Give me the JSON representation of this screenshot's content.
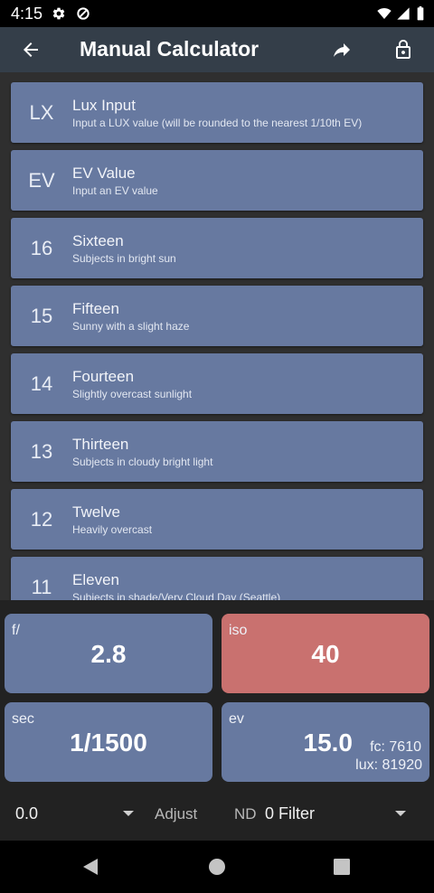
{
  "status_bar": {
    "time": "4:15",
    "left_icons": [
      "gear-icon",
      "data-saver-icon"
    ],
    "right_icons": [
      "wifi-icon",
      "cell-signal-icon",
      "battery-icon"
    ]
  },
  "app_bar": {
    "title": "Manual Calculator",
    "back_icon": "arrow-left-icon",
    "share_icon": "share-icon",
    "lock_icon": "lock-icon"
  },
  "ev_list": [
    {
      "badge": "LX",
      "title": "Lux Input",
      "subtitle": "Input a LUX value (will be rounded to the nearest 1/10th EV)"
    },
    {
      "badge": "EV",
      "title": "EV Value",
      "subtitle": "Input an EV value"
    },
    {
      "badge": "16",
      "title": "Sixteen",
      "subtitle": "Subjects in bright sun"
    },
    {
      "badge": "15",
      "title": "Fifteen",
      "subtitle": "Sunny with a slight haze"
    },
    {
      "badge": "14",
      "title": "Fourteen",
      "subtitle": "Slightly overcast sunlight"
    },
    {
      "badge": "13",
      "title": "Thirteen",
      "subtitle": "Subjects in cloudy bright light"
    },
    {
      "badge": "12",
      "title": "Twelve",
      "subtitle": "Heavily overcast"
    },
    {
      "badge": "11",
      "title": "Eleven",
      "subtitle": "Subjects in shade/Very Cloud Day (Seattle)"
    }
  ],
  "exposure": {
    "aperture": {
      "label": "f/",
      "value": "2.8"
    },
    "iso": {
      "label": "iso",
      "value": "40"
    },
    "shutter": {
      "label": "sec",
      "value": "1/1500"
    },
    "ev": {
      "label": "ev",
      "value": "15.0",
      "fc": "fc: 7610",
      "lux": "lux: 81920"
    }
  },
  "controls": {
    "adjust_value": "0.0",
    "adjust_label": "Adjust",
    "nd_label": "ND",
    "nd_value": "0 Filter"
  },
  "nav_bar": {
    "icons": [
      "nav-back-icon",
      "nav-home-icon",
      "nav-recents-icon"
    ]
  },
  "colors": {
    "card": "#6779a0",
    "iso_highlight": "#c9716f",
    "app_bar": "#343e49"
  }
}
